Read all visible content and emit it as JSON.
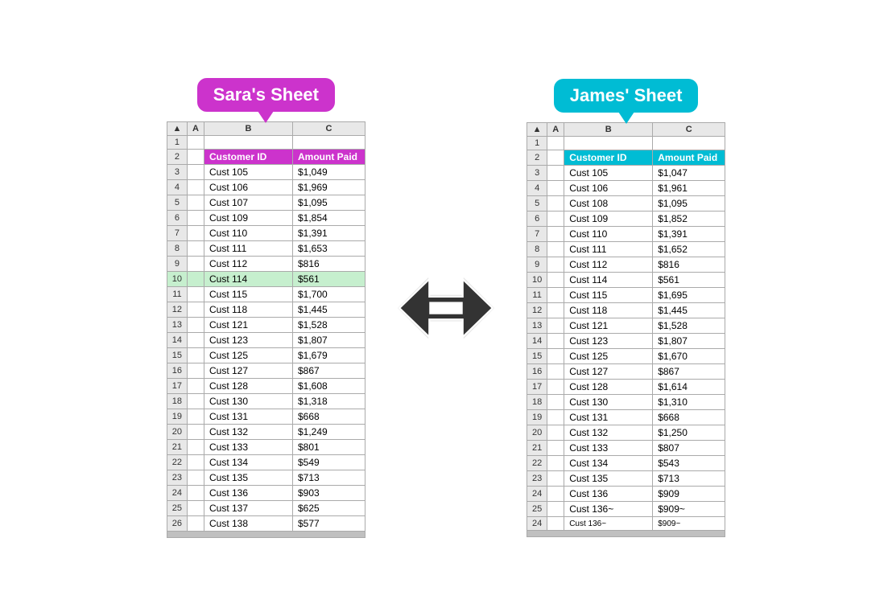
{
  "sara": {
    "bubble_label": "Sara's Sheet",
    "col_headers": [
      "A",
      "B",
      "C"
    ],
    "header_row": [
      "",
      "Customer ID",
      "Amount Paid"
    ],
    "rows": [
      {
        "num": 2,
        "cust": "Customer ID",
        "amount": "Amount Paid",
        "is_header": true
      },
      {
        "num": 3,
        "cust": "Cust 105",
        "amount": "$1,049"
      },
      {
        "num": 4,
        "cust": "Cust 106",
        "amount": "$1,969"
      },
      {
        "num": 5,
        "cust": "Cust 107",
        "amount": "$1,095"
      },
      {
        "num": 6,
        "cust": "Cust 109",
        "amount": "$1,854"
      },
      {
        "num": 7,
        "cust": "Cust 110",
        "amount": "$1,391"
      },
      {
        "num": 8,
        "cust": "Cust 111",
        "amount": "$1,653"
      },
      {
        "num": 9,
        "cust": "Cust 112",
        "amount": "$816"
      },
      {
        "num": 10,
        "cust": "Cust 114",
        "amount": "$561",
        "highlight": true
      },
      {
        "num": 11,
        "cust": "Cust 115",
        "amount": "$1,700"
      },
      {
        "num": 12,
        "cust": "Cust 118",
        "amount": "$1,445"
      },
      {
        "num": 13,
        "cust": "Cust 121",
        "amount": "$1,528"
      },
      {
        "num": 14,
        "cust": "Cust 123",
        "amount": "$1,807"
      },
      {
        "num": 15,
        "cust": "Cust 125",
        "amount": "$1,679"
      },
      {
        "num": 16,
        "cust": "Cust 127",
        "amount": "$867"
      },
      {
        "num": 17,
        "cust": "Cust 128",
        "amount": "$1,608"
      },
      {
        "num": 18,
        "cust": "Cust 130",
        "amount": "$1,318"
      },
      {
        "num": 19,
        "cust": "Cust 131",
        "amount": "$668"
      },
      {
        "num": 20,
        "cust": "Cust 132",
        "amount": "$1,249"
      },
      {
        "num": 21,
        "cust": "Cust 133",
        "amount": "$801"
      },
      {
        "num": 22,
        "cust": "Cust 134",
        "amount": "$549"
      },
      {
        "num": 23,
        "cust": "Cust 135",
        "amount": "$713"
      },
      {
        "num": 24,
        "cust": "Cust 136",
        "amount": "$903"
      },
      {
        "num": 25,
        "cust": "Cust 137",
        "amount": "$625"
      },
      {
        "num": 26,
        "cust": "Cust 138",
        "amount": "$577"
      }
    ]
  },
  "james": {
    "bubble_label": "James' Sheet",
    "col_headers": [
      "A",
      "B",
      "C"
    ],
    "header_row": [
      "",
      "Customer ID",
      "Amount Paid"
    ],
    "rows": [
      {
        "num": 2,
        "cust": "Customer ID",
        "amount": "Amount Paid",
        "is_header": true
      },
      {
        "num": 3,
        "cust": "Cust 105",
        "amount": "$1,047"
      },
      {
        "num": 4,
        "cust": "Cust 106",
        "amount": "$1,961"
      },
      {
        "num": 5,
        "cust": "Cust 108",
        "amount": "$1,095"
      },
      {
        "num": 6,
        "cust": "Cust 109",
        "amount": "$1,852"
      },
      {
        "num": 7,
        "cust": "Cust 110",
        "amount": "$1,391"
      },
      {
        "num": 8,
        "cust": "Cust 111",
        "amount": "$1,652"
      },
      {
        "num": 9,
        "cust": "Cust 112",
        "amount": "$816"
      },
      {
        "num": 10,
        "cust": "Cust 114",
        "amount": "$561"
      },
      {
        "num": 11,
        "cust": "Cust 115",
        "amount": "$1,695"
      },
      {
        "num": 12,
        "cust": "Cust 118",
        "amount": "$1,445"
      },
      {
        "num": 13,
        "cust": "Cust 121",
        "amount": "$1,528"
      },
      {
        "num": 14,
        "cust": "Cust 123",
        "amount": "$1,807"
      },
      {
        "num": 15,
        "cust": "Cust 125",
        "amount": "$1,670"
      },
      {
        "num": 16,
        "cust": "Cust 127",
        "amount": "$867"
      },
      {
        "num": 17,
        "cust": "Cust 128",
        "amount": "$1,614"
      },
      {
        "num": 18,
        "cust": "Cust 130",
        "amount": "$1,310"
      },
      {
        "num": 19,
        "cust": "Cust 131",
        "amount": "$668"
      },
      {
        "num": 20,
        "cust": "Cust 132",
        "amount": "$1,250"
      },
      {
        "num": 21,
        "cust": "Cust 133",
        "amount": "$807"
      },
      {
        "num": 22,
        "cust": "Cust 134",
        "amount": "$543"
      },
      {
        "num": 23,
        "cust": "Cust 135",
        "amount": "$713"
      },
      {
        "num": 24,
        "cust": "Cust 136",
        "amount": "$909"
      },
      {
        "num": 25,
        "cust": "Cust 136~",
        "amount": "$909~"
      }
    ]
  }
}
